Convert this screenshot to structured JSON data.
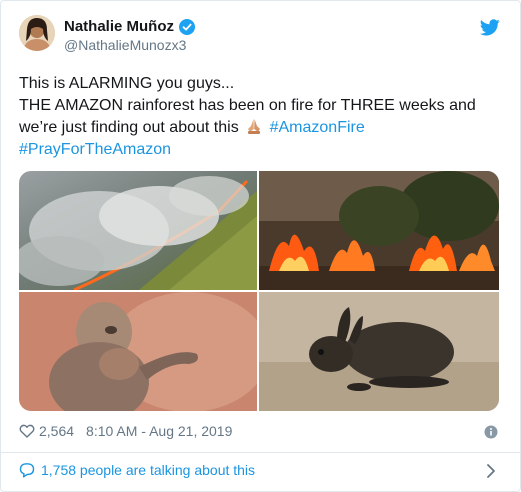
{
  "author": {
    "display_name": "Nathalie Muñoz",
    "handle": "@NathalieMunozx3",
    "verified": true
  },
  "tweet": {
    "line1": "This is ALARMING you guys...",
    "line2": "THE AMAZON rainforest has been on fire for THREE weeks and",
    "line3_text": "we’re just finding out about this",
    "hashtag1": "#AmazonFire",
    "hashtag2": "#PrayForTheAmazon"
  },
  "media": [
    {
      "icon": "aerial-forest-fire-photo"
    },
    {
      "icon": "forest-flames-photo"
    },
    {
      "icon": "monkeys-photo"
    },
    {
      "icon": "burned-rabbit-photo"
    }
  ],
  "footer": {
    "likes": "2,564",
    "timestamp": "8:10 AM - Aug 21, 2019",
    "talking": "1,758 people are talking about this"
  },
  "colors": {
    "link": "#1b95e0",
    "muted": "#657786",
    "twitter_blue": "#1da1f2"
  }
}
